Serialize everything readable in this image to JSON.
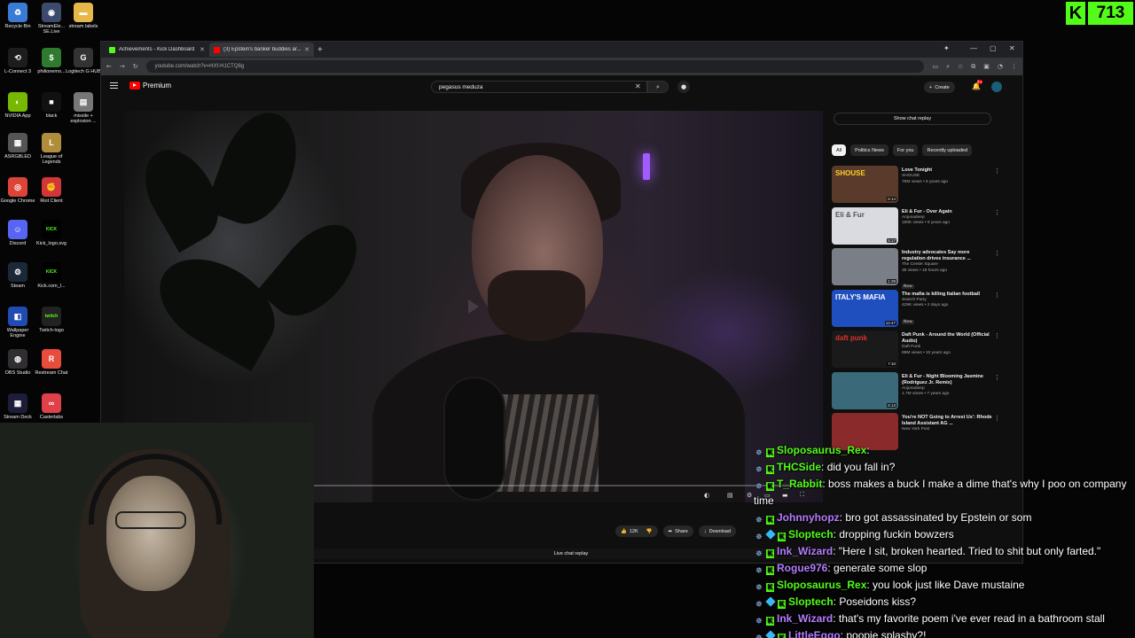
{
  "desktop": {
    "icons": [
      {
        "label": "Recycle Bin",
        "name": "recycle-bin-icon",
        "color": "#3a7bd5",
        "glyph": "♻"
      },
      {
        "label": "StreamEle... SE.Live",
        "name": "streamelements-icon",
        "color": "#3c4b6b",
        "glyph": "◉"
      },
      {
        "label": "stream labels",
        "name": "folder-icon",
        "color": "#e6b84a",
        "glyph": "▬"
      },
      {
        "label": "L-Connect 3",
        "name": "lconnect-icon",
        "color": "#1d1d1d",
        "glyph": "⟲"
      },
      {
        "label": "philionemo...",
        "name": "app-icon",
        "color": "#2f7a2f",
        "glyph": "$"
      },
      {
        "label": "Logitech G HUB",
        "name": "logitech-icon",
        "color": "#333",
        "glyph": "G"
      },
      {
        "label": "NVIDIA App",
        "name": "nvidia-icon",
        "color": "#76b900",
        "glyph": "◐"
      },
      {
        "label": "black",
        "name": "black-file-icon",
        "color": "#111",
        "glyph": "■"
      },
      {
        "label": "missile + explosion ...",
        "name": "missile-file-icon",
        "color": "#777",
        "glyph": "▤"
      },
      {
        "label": "ASRGBLED",
        "name": "asrgbled-icon",
        "color": "#555",
        "glyph": "▦"
      },
      {
        "label": "League of Legends",
        "name": "league-icon",
        "color": "#b08d3b",
        "glyph": "L"
      },
      {
        "label": "Google Chrome",
        "name": "chrome-icon",
        "color": "#db4437",
        "glyph": "◎"
      },
      {
        "label": "Riot Client",
        "name": "riot-icon",
        "color": "#d13639",
        "glyph": "✊"
      },
      {
        "label": "Discord",
        "name": "discord-icon",
        "color": "#5865f2",
        "glyph": "☺"
      },
      {
        "label": "Kick_logo.svg",
        "name": "kick-logo-file-icon",
        "color": "#000",
        "glyph": "KICK"
      },
      {
        "label": "Steam",
        "name": "steam-icon",
        "color": "#1b2838",
        "glyph": "⚙"
      },
      {
        "label": "Kick.com_l...",
        "name": "kick-file-icon",
        "color": "#000",
        "glyph": "KICK"
      },
      {
        "label": "Wallpaper Engine",
        "name": "wallpaper-engine-icon",
        "color": "#1f4bb3",
        "glyph": "◧"
      },
      {
        "label": "Twitch-logo",
        "name": "twitch-file-icon",
        "color": "#222",
        "glyph": "twitch"
      },
      {
        "label": "OBS Studio",
        "name": "obs-icon",
        "color": "#302e31",
        "glyph": "◍"
      },
      {
        "label": "Restream Chat",
        "name": "restream-icon",
        "color": "#e74c3c",
        "glyph": "R"
      },
      {
        "label": "Stream Deck",
        "name": "stream-deck-icon",
        "color": "#1d1d3a",
        "glyph": "▦"
      },
      {
        "label": "Casterlabs",
        "name": "casterlabs-icon",
        "color": "#e0404a",
        "glyph": "∞"
      }
    ]
  },
  "kick_badge": {
    "count": "713"
  },
  "browser": {
    "tabs": [
      {
        "title": "Achievements - Kick Dashboard",
        "favicon_color": "#53fc18",
        "active": false
      },
      {
        "title": "(3) Epstein's banker buddies ar...",
        "favicon_color": "#ff0000",
        "active": true
      }
    ],
    "url": "youtube.com/watch?v=HXf-H1CTQ8g"
  },
  "youtube": {
    "logo_text": "Premium",
    "search_value": "pegasus meduza",
    "create_label": "Create",
    "notification_count": "9+",
    "show_chat_replay": "Show chat replay",
    "chips": [
      "All",
      "Politics News",
      "For you",
      "Recently uploaded"
    ],
    "actions": {
      "likes": "12K",
      "share": "Share",
      "download": "Download"
    },
    "live_chat_replay": "Live chat replay",
    "recommendations": [
      {
        "title": "Love Tonight",
        "channel": "SHOUSE",
        "stats": "76M views • 5 years ago",
        "duration": "6:14",
        "thumb_color": "#5a3a2a",
        "thumb_text": "SHOUSE",
        "thumb_text_color": "#ffd12b",
        "new": ""
      },
      {
        "title": "Eli & Fur - Over Again",
        "channel": "Anjunadeep",
        "stats": "150K views • 9 years ago",
        "duration": "5:17",
        "thumb_color": "#d9dbe0",
        "thumb_text": "Eli & Fur",
        "thumb_text_color": "#555",
        "new": ""
      },
      {
        "title": "Industry advocates Say more regulation drives insurance ...",
        "channel": "The Center Square",
        "stats": "39 views • 19 hours ago",
        "duration": "1:29",
        "thumb_color": "#7a7e86",
        "thumb_text": "",
        "thumb_text_color": "#fff",
        "new": "New"
      },
      {
        "title": "The mafia is killing Italian football",
        "channel": "Search Party",
        "stats": "429K views • 2 days ago",
        "duration": "12:47",
        "thumb_color": "#1f4fbf",
        "thumb_text": "ITALY'S MAFIA",
        "thumb_text_color": "#fff",
        "new": "New"
      },
      {
        "title": "Daft Punk - Around the World (Official Audio)",
        "channel": "Daft Punk",
        "stats": "89M views • 10 years ago",
        "duration": "7:10",
        "thumb_color": "#1a1a1a",
        "thumb_text": "daft punk",
        "thumb_text_color": "#e03030",
        "new": ""
      },
      {
        "title": "Eli & Fur - Night Blooming Jasmine (Rodriguez Jr. Remix)",
        "channel": "Anjunadeep",
        "stats": "1.7M views • 7 years ago",
        "duration": "6:13",
        "thumb_color": "#3a6a7a",
        "thumb_text": "",
        "thumb_text_color": "#fff",
        "new": ""
      },
      {
        "title": "You're NOT Going to Arrest Us': Rhode Island Assistant AG ...",
        "channel": "New York Post",
        "stats": "",
        "duration": "",
        "thumb_color": "#8a2a2a",
        "thumb_text": "",
        "thumb_text_color": "#fff",
        "new": ""
      }
    ]
  },
  "chat": {
    "messages": [
      {
        "user": "Sloposaurus_Rex",
        "color": "#53fc18",
        "text": "",
        "cube": false
      },
      {
        "user": "THCSide",
        "color": "#53fc18",
        "text": "did you fall in?",
        "cube": false
      },
      {
        "user": "T_Rabbit",
        "color": "#53fc18",
        "text": "boss makes a buck I make a dime that's why I poo on company time",
        "cube": false
      },
      {
        "user": "Johnnyhopz",
        "color": "#b57cff",
        "text": "bro got assassinated by Epstein or som",
        "cube": false
      },
      {
        "user": "Sloptech",
        "color": "#53fc18",
        "text": "dropping fuckin bowzers",
        "cube": true
      },
      {
        "user": "Ink_Wizard",
        "color": "#b57cff",
        "text": "\"Here I sit, broken hearted. Tried to shit but only farted.\"",
        "cube": false
      },
      {
        "user": "Rogue976",
        "color": "#b57cff",
        "text": "generate some slop",
        "cube": false
      },
      {
        "user": "Sloposaurus_Rex",
        "color": "#53fc18",
        "text": "you look just like Dave mustaine",
        "cube": false
      },
      {
        "user": "Sloptech",
        "color": "#53fc18",
        "text": "Poseidons kiss?",
        "cube": true
      },
      {
        "user": "Ink_Wizard",
        "color": "#b57cff",
        "text": "that's my favorite poem i've ever read in a bathroom stall",
        "cube": false
      },
      {
        "user": "LittleEggo",
        "color": "#b57cff",
        "text": "poopie splashy?!",
        "cube": true
      }
    ]
  }
}
